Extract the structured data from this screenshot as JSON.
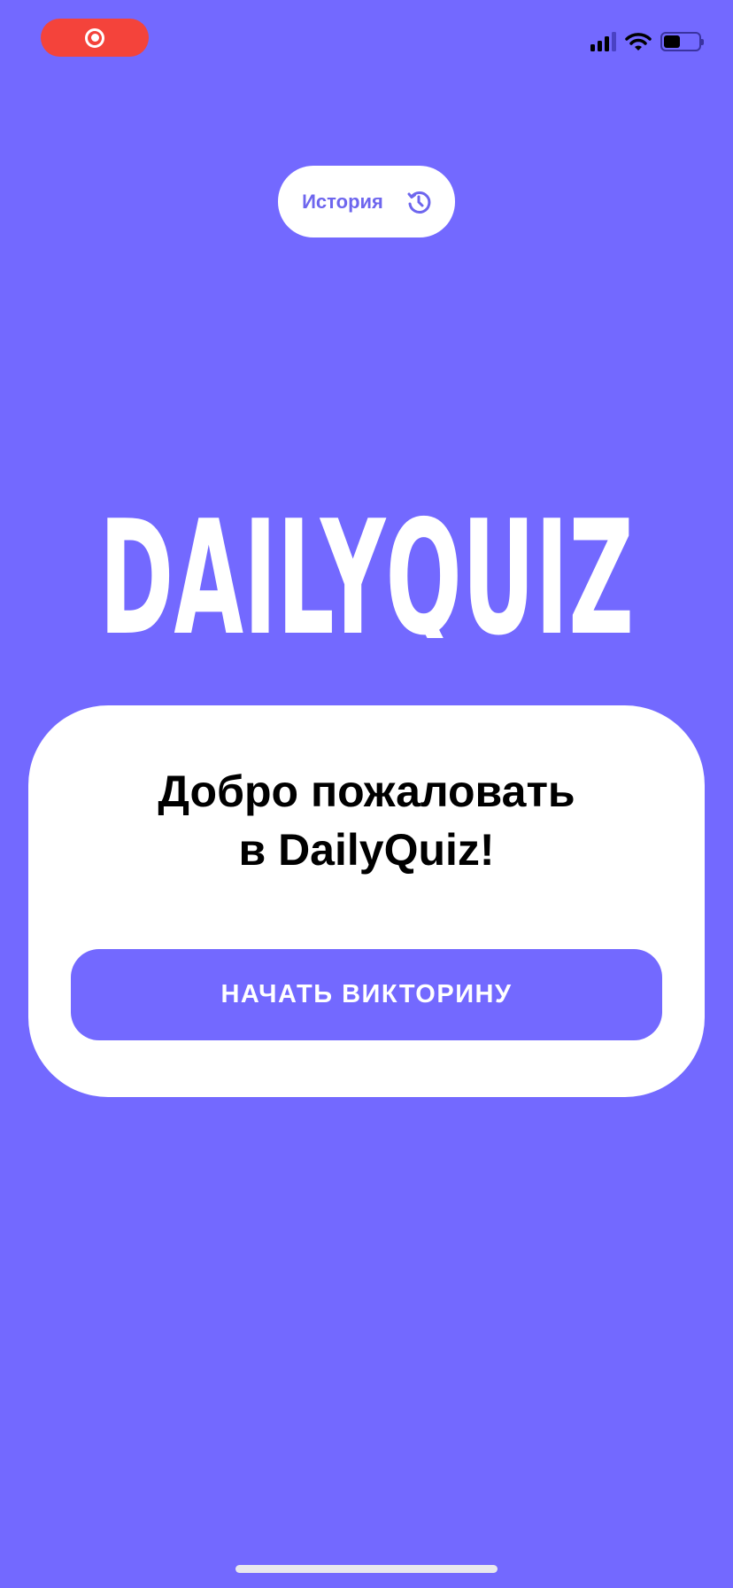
{
  "status_bar": {
    "recording_icon": "screen-record-icon",
    "signal_icon": "cellular-signal-icon",
    "wifi_icon": "wifi-icon",
    "battery_icon": "battery-icon"
  },
  "header": {
    "history_label": "История",
    "history_icon": "history-clock-icon"
  },
  "logo": {
    "text": "DAILYQUIZ"
  },
  "card": {
    "title_line1": "Добро пожаловать",
    "title_line2": "в DailyQuiz!",
    "start_button": "НАЧАТЬ ВИКТОРИНУ"
  },
  "colors": {
    "background": "#7369ff",
    "card": "#ffffff",
    "record": "#f4433b"
  }
}
